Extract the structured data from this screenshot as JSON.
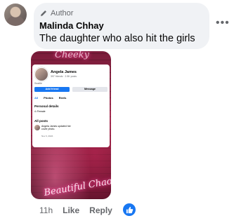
{
  "comment": {
    "author_label": "Author",
    "name": "Malinda Chhay",
    "text": "The daughter who also hit the girls",
    "more_icon": "more-horizontal-icon",
    "time": "11h",
    "like_label": "Like",
    "reply_label": "Reply",
    "reaction_icon": "like-reaction-icon"
  },
  "screenshot": {
    "neon_top": "Cheeky",
    "neon_bottom": "Beautiful Chaos",
    "profile_name": "Angela James",
    "stats": "397 friends · 2.5K posts",
    "bio": "Seattle",
    "add_friend": "Add friend",
    "message": "Message",
    "tabs": [
      "All",
      "Photos",
      "Reels"
    ],
    "personal_details": "Personal details",
    "gender": "Female",
    "all_posts": "All posts",
    "post_text": "Angela James updated her cover photo.",
    "post_date": "Nov 3, 2024 ·"
  },
  "colors": {
    "accent": "#1877f2",
    "bubble": "#f0f2f5",
    "muted": "#65676b"
  }
}
